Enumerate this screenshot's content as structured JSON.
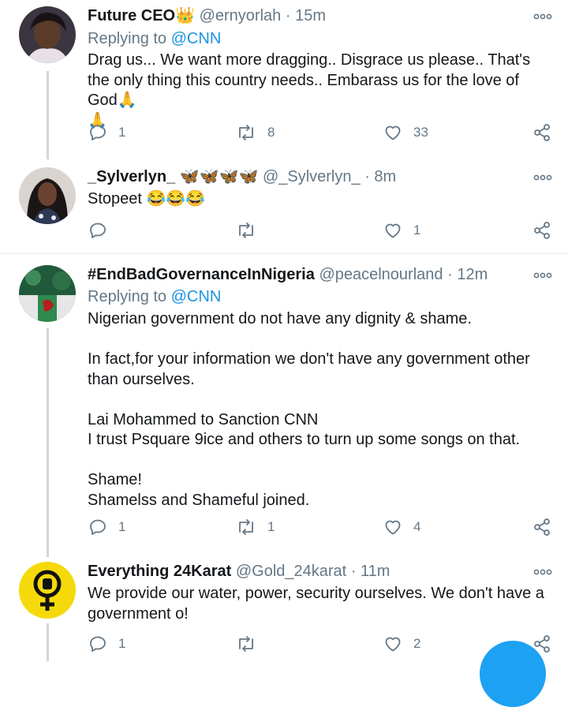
{
  "tweets": [
    {
      "name": "Future CEO",
      "name_emoji": "👑",
      "handle": "@ernyorlah",
      "time": "15m",
      "replying_label": "Replying to",
      "replying_to": "@CNN",
      "text": "Drag us... We want more dragging.. Disgrace us please.. That's the only thing this country needs.. Embarass us for the love of God🙏\n🙏",
      "reply_count": "1",
      "retweet_count": "8",
      "like_count": "33"
    },
    {
      "name": "_Sylverlyn_",
      "name_emoji": "🦋🦋🦋🦋",
      "handle": "@_Sylverlyn_",
      "time": "8m",
      "text": "Stopeet 😂😂😂",
      "reply_count": "",
      "retweet_count": "",
      "like_count": "1"
    },
    {
      "name": "#EndBadGovernanceInNigeria",
      "handle": "@peacelnourland",
      "time": "12m",
      "replying_label": "Replying to",
      "replying_to": "@CNN",
      "text": "Nigerian government do not have any dignity & shame.\n\nIn fact,for your information we don't have any government other than ourselves.\n\nLai Mohammed to Sanction CNN\nI trust Psquare 9ice and others to turn up some songs on that.\n\nShame!\nShamelss and Shameful joined.",
      "reply_count": "1",
      "retweet_count": "1",
      "like_count": "4"
    },
    {
      "name": "Everything 24Karat",
      "handle": "@Gold_24karat",
      "time": "11m",
      "text": "We provide our water, power, security ourselves. We don't have a government o!",
      "reply_count": "1",
      "retweet_count": "",
      "like_count": "2"
    }
  ],
  "separator": "·",
  "colors": {
    "accent": "#1da1f2",
    "mention": "#1b95e0",
    "muted": "#657786",
    "thread_line": "#ccd6dd"
  }
}
